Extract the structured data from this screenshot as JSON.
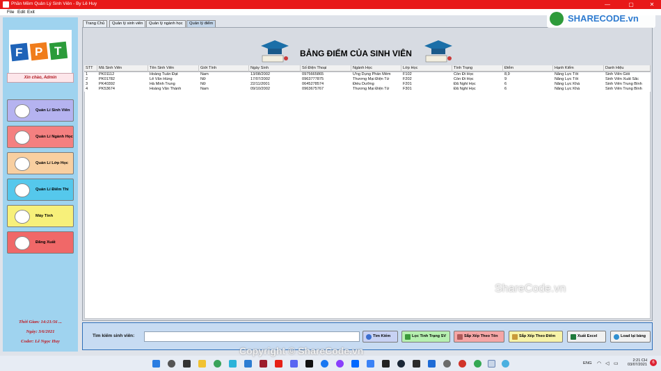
{
  "window": {
    "title": "Phần Mềm Quản Lý Sinh Viên - By Lê Huy",
    "menu": [
      "File",
      "Edit",
      "Exit"
    ],
    "controls": {
      "minimize": "—",
      "maximize": "▢",
      "close": "✕"
    }
  },
  "sidebar": {
    "logo_text": "FPT",
    "greeting": "Xin chào, Admin",
    "nav": [
      {
        "label": "Quản Lí Sinh Viên",
        "color": "#b5b3f0",
        "icon": "student-icon"
      },
      {
        "label": "Quản Lí Ngành Học",
        "color": "#f48080",
        "icon": "major-icon"
      },
      {
        "label": "Quản Lí Lớp Học",
        "color": "#f8cfa0",
        "icon": "classroom-icon"
      },
      {
        "label": "Quản Lí Điểm Thi",
        "color": "#55c8ec",
        "icon": "exam-icon"
      },
      {
        "label": "Máy Tính",
        "color": "#f7f07a",
        "icon": "computer-icon"
      },
      {
        "label": "Đăng Xuất",
        "color": "#f06868",
        "icon": "logout-icon"
      }
    ],
    "time_label": "Thời Gian: 14:21:56 ...",
    "date_label": "Ngày: 3/6/2021",
    "coder_label": "Coder: Lê Ngọc Huy"
  },
  "tabs": [
    "Trang Chủ",
    "Quản lý sinh viên",
    "Quản lý ngành học",
    "Quản lý điểm"
  ],
  "active_tab": 3,
  "page_title": "BẢNG ĐIỂM CỦA SINH VIÊN",
  "table": {
    "columns": [
      "STT",
      "Mã Sinh Viên",
      "Tên Sinh Viên",
      "Giới Tính",
      "Ngày Sinh",
      "Số Điện Thoại",
      "Ngành Học",
      "Lớp Học",
      "Tình Trạng",
      "Điểm",
      "Hạnh Kiểm",
      "Danh Hiệu"
    ],
    "rows": [
      [
        "1",
        "PK01112",
        "Hoàng Tuấn Đạt",
        "Nam",
        "13/08/2002",
        "0975665865",
        "Ứng Dụng Phần Mềm",
        "F102",
        "Còn Đi Học",
        "8,9",
        "Năng Lực Tốt",
        "Sinh Viên Giỏi"
      ],
      [
        "2",
        "PK01782",
        "Lê Văn Hùng",
        "Nữ",
        "17/07/2002",
        "0963777875",
        "Thương Mại Điện Tử",
        "F202",
        "Còn Đi Học",
        "9",
        "Năng Lực Tốt",
        "Sinh Viên Xuất Sắc"
      ],
      [
        "3",
        "PK40392",
        "Hà Minh Trung",
        "Nữ",
        "22/11/2001",
        "0645278574",
        "Điều Dưỡng",
        "F201",
        "Đã Nghỉ Học",
        "6",
        "Năng Lực Khá",
        "Sinh Viên Trung Bình"
      ],
      [
        "4",
        "PK53674",
        "Hoàng Văn Thành",
        "Nam",
        "09/10/2002",
        "0963675767",
        "Thương Mại Điện Tử",
        "F301",
        "Đã Nghỉ Học",
        "6",
        "Năng Lực Khá",
        "Sinh Viên Trung Bình"
      ]
    ]
  },
  "search": {
    "label": "Tìm kiếm sinh viên:",
    "value": "",
    "buttons": [
      {
        "label": "Tìm Kiếm",
        "color": "#c8d2f4",
        "icon": "search-icon"
      },
      {
        "label": "Lọc Tình Trạng SV",
        "color": "#b6f0b0",
        "icon": "filter-icon"
      },
      {
        "label": "Sắp Xếp Theo Tên",
        "color": "#f5a6a6",
        "icon": "sort-name-icon"
      },
      {
        "label": "Sắp Xếp Theo Điểm",
        "color": "#f7f3a8",
        "icon": "sort-score-icon"
      },
      {
        "label": "Xuất Excel",
        "color": "#f1f1f1",
        "icon": "excel-icon"
      },
      {
        "label": "Load lại bảng",
        "color": "#f1f1f1",
        "icon": "reload-icon"
      }
    ]
  },
  "watermarks": {
    "brand": "SHARECODE.vn",
    "center": "ShareCode.vn",
    "copyright": "Copyright © ShareCode.vn"
  },
  "taskbar": {
    "lang": "ENG",
    "time": "2:21 CH",
    "date": "03/07/2021",
    "badge": "6"
  }
}
